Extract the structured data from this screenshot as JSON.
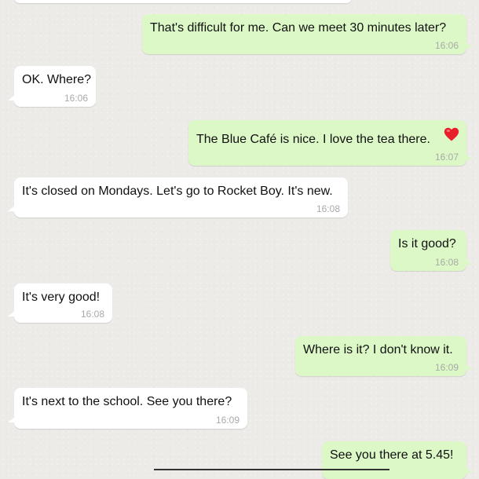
{
  "messages": [
    {
      "direction": "outgoing",
      "text": "That's difficult for me. Can we meet 30 minutes later?",
      "time": "16:06"
    },
    {
      "direction": "incoming",
      "text": "OK. Where?",
      "time": "16:06"
    },
    {
      "direction": "outgoing",
      "text": "The Blue Café is nice. I love the tea there.",
      "time": "16:07",
      "emoji": "heart"
    },
    {
      "direction": "incoming",
      "text": "It's closed on Mondays. Let's go to Rocket Boy. It's new.",
      "time": "16:08"
    },
    {
      "direction": "outgoing",
      "text": "Is it good?",
      "time": "16:08"
    },
    {
      "direction": "incoming",
      "text": "It's very good!",
      "time": "16:08"
    },
    {
      "direction": "outgoing",
      "text": "Where is it? I don't know it.",
      "time": "16:09"
    },
    {
      "direction": "incoming",
      "text": "It's next to the school. See you there?",
      "time": "16:09"
    },
    {
      "direction": "outgoing",
      "text": "See you there at 5.45!",
      "time": ""
    }
  ],
  "colors": {
    "background": "#ecebe8",
    "incoming_bubble": "#ffffff",
    "outgoing_bubble": "#dcf8c6",
    "message_text": "#111111",
    "timestamp": "#a9a9a9",
    "heart": "#e8202a"
  }
}
